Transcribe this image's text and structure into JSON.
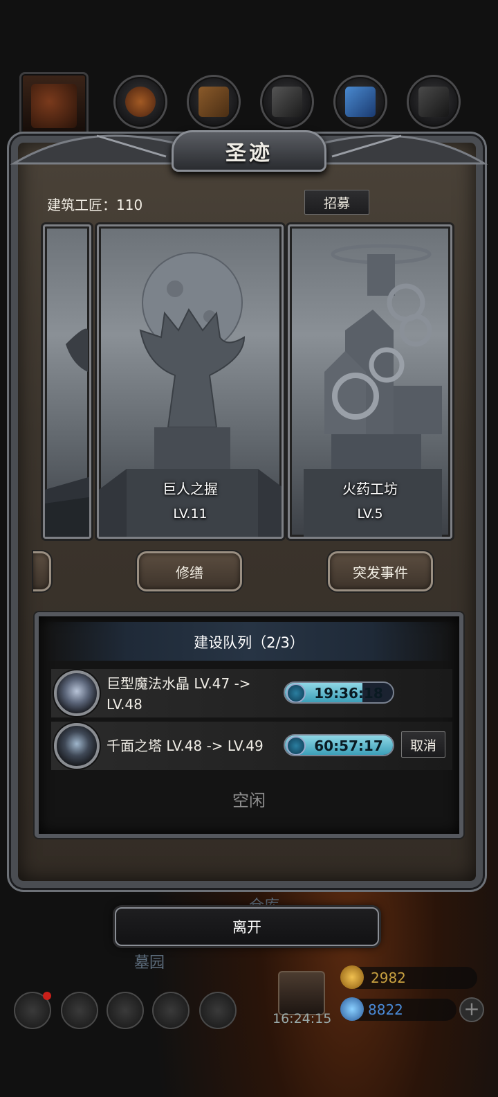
{
  "top_resources": [
    "spear-icon",
    "food-icon",
    "wood-icon",
    "iron-icon",
    "crystal-icon",
    "stone-icon"
  ],
  "panel": {
    "title": "圣迹",
    "builders_label": "建筑工匠：110",
    "recruit_label": "招募"
  },
  "buildings": [
    {
      "name": "巨人之握",
      "level": "LV.11",
      "action": "修缮"
    },
    {
      "name": "火药工坊",
      "level": "LV.5",
      "action": "突发事件"
    }
  ],
  "queue": {
    "title": "建设队列（2/3）",
    "items": [
      {
        "name": "巨型魔法水晶 LV.47 -> LV.48",
        "time": "19:36:18",
        "progress": 0.72
      },
      {
        "name": "千面之塔 LV.48 -> LV.49",
        "time": "60:57:17",
        "progress": 1.0,
        "cancel_label": "取消"
      }
    ],
    "idle_label": "空闲"
  },
  "leave_label": "离开",
  "background": {
    "warehouse_label": "仓库",
    "cemetery_label": "墓园",
    "clock": "16:24:15",
    "gold": "2982",
    "gems": "8822"
  },
  "colors": {
    "panel_brown": "#3c352d",
    "frame_silver": "#8a8e95",
    "timer_cyan": "#8fd7e6"
  }
}
